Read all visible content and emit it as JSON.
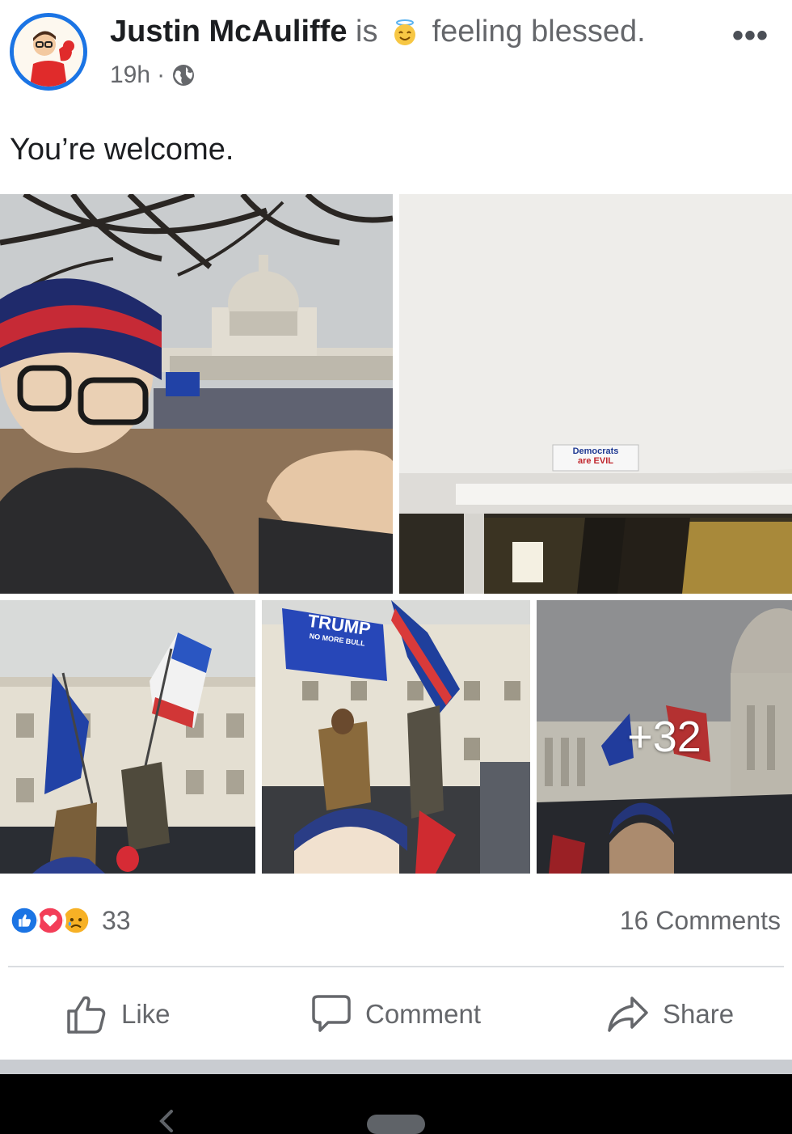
{
  "post": {
    "author": "Justin McAuliffe",
    "verb": "is",
    "feeling_icon": "angel-smile-emoji",
    "feeling": "feeling blessed.",
    "time": "19h",
    "separator": "·",
    "audience_icon": "globe-icon",
    "more_icon": "more-options-icon",
    "more_label": "•••",
    "text": "You’re welcome."
  },
  "photos": {
    "photo_1": "selfie-capitol-photo",
    "photo_2": "wall-sticker-photo",
    "sticker_line1": "Democrats",
    "sticker_line2": "are EVIL",
    "photo_3": "flags-crowd-photo",
    "photo_4": "trump-flag-crowd-photo",
    "flag_line1": "TRUMP",
    "flag_line2": "NO MORE BULL",
    "photo_5": "capitol-steps-photo",
    "more_count": "+32"
  },
  "reactions": {
    "icons": [
      "like-reaction-icon",
      "love-reaction-icon",
      "sad-reaction-icon"
    ],
    "count": "33",
    "comments": "16 Comments"
  },
  "actions": {
    "like": "Like",
    "comment": "Comment",
    "share": "Share"
  },
  "colors": {
    "brand_blue": "#1b74e4",
    "secondary_text": "#65676b",
    "love_red": "#f33e58",
    "sad_yellow": "#f7b125"
  }
}
